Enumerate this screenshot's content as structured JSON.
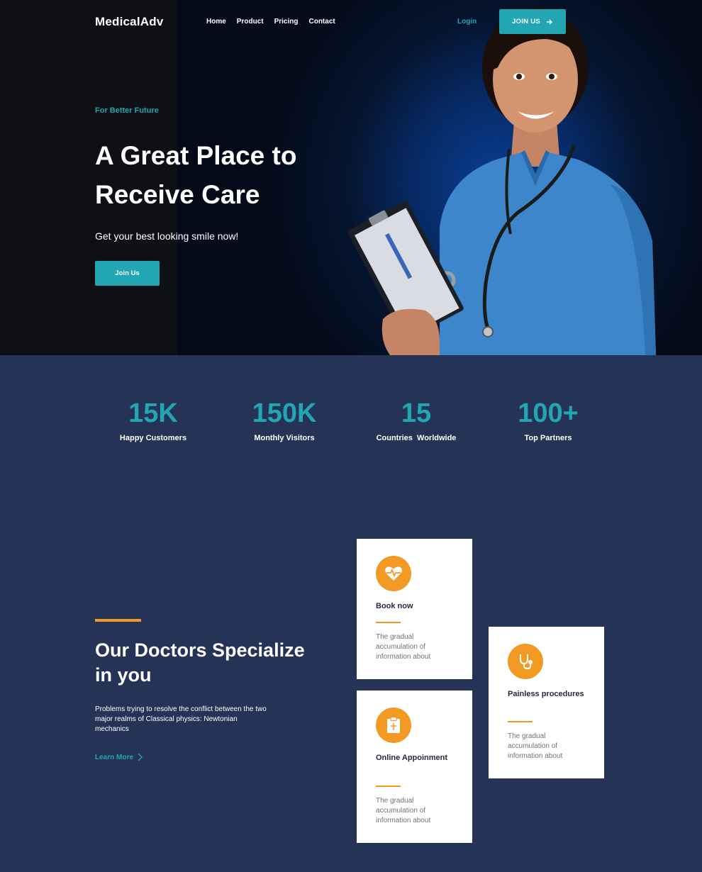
{
  "nav": {
    "logo": "MedicalAdv",
    "links": [
      "Home",
      "Product",
      "Pricing",
      "Contact"
    ],
    "login": "Login",
    "join_button": "JOIN US"
  },
  "hero": {
    "eyebrow": "For Better Future",
    "title": "A Great Place to Receive Care",
    "subtitle": "Get your best looking smile now!",
    "cta": "Join Us"
  },
  "stats": [
    {
      "value": "15K",
      "label": "Happy Customers"
    },
    {
      "value": "150K",
      "label": "Monthly Visitors"
    },
    {
      "value": "15",
      "label": "Countries  Worldwide"
    },
    {
      "value": "100+",
      "label": "Top Partners"
    }
  ],
  "specialize": {
    "title": "Our Doctors Specialize in you",
    "body": "Problems trying to resolve the conflict between the two major realms of Classical physics: Newtonian mechanics",
    "link": "Learn More"
  },
  "cards": [
    {
      "icon": "heartbeat-icon",
      "title": "Book now",
      "text": "The gradual accumulation of information about"
    },
    {
      "icon": "clipboard-icon",
      "title": "Online Appoinment",
      "text": "The gradual accumulation of information about"
    },
    {
      "icon": "stethoscope-icon",
      "title": "Painless procedures",
      "text": "The gradual accumulation of information about"
    }
  ],
  "colors": {
    "accent": "#23a6b3",
    "orange": "#f39a25",
    "navy": "#253357"
  }
}
